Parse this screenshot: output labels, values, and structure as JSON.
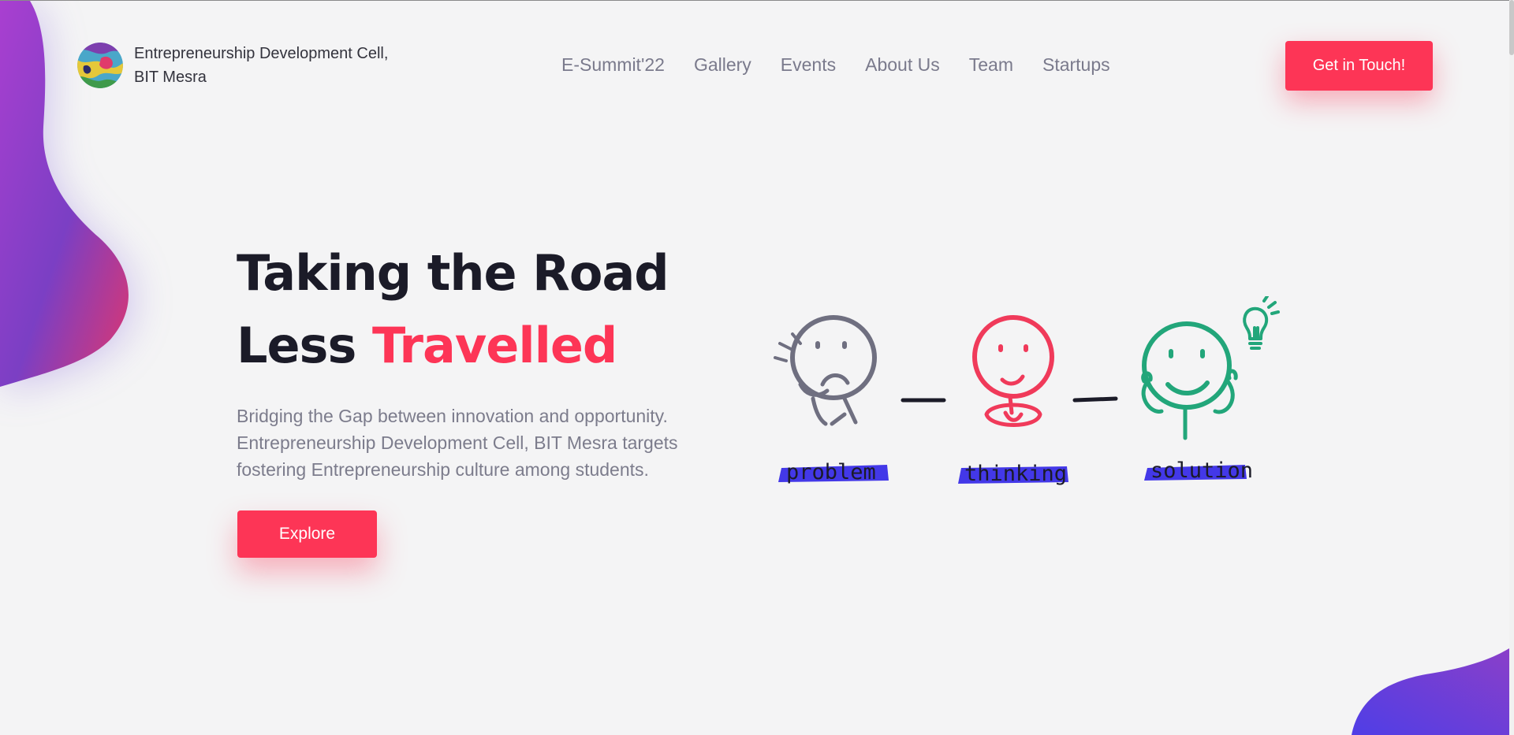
{
  "brand": {
    "name_line1": "Entrepreneurship Development Cell,",
    "name_line2": "BIT Mesra",
    "logo_icon": "edc-logo-icon"
  },
  "nav": {
    "items": [
      {
        "label": "E-Summit'22"
      },
      {
        "label": "Gallery"
      },
      {
        "label": "Events"
      },
      {
        "label": "About Us"
      },
      {
        "label": "Team"
      },
      {
        "label": "Startups"
      }
    ],
    "cta_label": "Get in Touch!"
  },
  "hero": {
    "headline_line1": "Taking the Road",
    "headline_line2_prefix": "Less ",
    "headline_accent": "Travelled",
    "subtext": "Bridging the Gap between innovation and opportunity. Entrepreneurship Development Cell, BIT Mesra targets fostering Entrepreneurship culture among students.",
    "button_label": "Explore"
  },
  "illustration": {
    "labels": [
      "problem",
      "thinking",
      "solution"
    ],
    "icons": [
      "sad-face-icon",
      "neutral-face-icon",
      "happy-face-icon",
      "lightbulb-icon"
    ]
  },
  "colors": {
    "accent": "#fd3556",
    "highlight": "#4338e8",
    "blob_gradient": [
      "#7b3ff2",
      "#e0366d"
    ],
    "sad_face": "#6f6f80",
    "thinking_face": "#f03a5a",
    "happy_face": "#22a67a",
    "text_dark": "#1b1b28",
    "text_muted": "#7c7c8c",
    "background": "#f4f4f5"
  }
}
